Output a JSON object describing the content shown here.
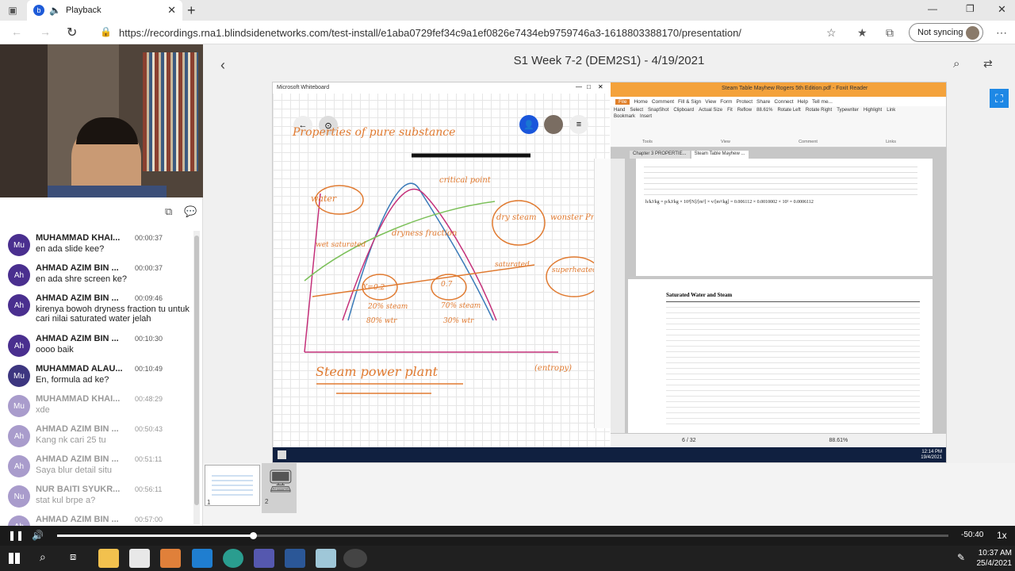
{
  "browser": {
    "tab_title": "Playback",
    "url": "https://recordings.rna1.blindsidenetworks.com/test-install/e1aba0729fef34c9a1ef0826e7434eb9759746a3-1618803388170/presentation/",
    "sync_label": "Not syncing"
  },
  "presentation": {
    "title": "S1 Week 7-2 (DEM2S1) - 4/19/2021",
    "whiteboard_title": "Microsoft Whiteboard",
    "pdf_title": "Steam Table Mayhew Rogers 5th Edition.pdf - Foxit Reader",
    "pdf_tabs": [
      "Chapter 3 PROPERTIE...",
      "Steam Table Mayhew ..."
    ],
    "pdf_menu": [
      "File",
      "Home",
      "Comment",
      "Fill & Sign",
      "View",
      "Form",
      "Protect",
      "Share",
      "Connect",
      "Help",
      "Tell me..."
    ],
    "pdf_tools": [
      "Hand",
      "Select",
      "SnapShot",
      "Clipboard",
      "Actual Size",
      "Fit",
      "Reflow",
      "88.61%",
      "Rotate Left",
      "Rotate Right",
      "Typewriter",
      "Highlight",
      "Link",
      "Bookmark",
      "Insert"
    ],
    "pdf_groups": [
      "Tools",
      "View",
      "Comment",
      "Links"
    ],
    "table_title": "Saturated Water and Steam",
    "page_indicator": "6 / 32",
    "zoom": "88.61%",
    "clock_time": "12:14 PM",
    "clock_date": "19/4/2021",
    "whiteboard_text": [
      "Properties of pure substance",
      "critical point",
      "water",
      "dry steam",
      "dryness fraction",
      "wet saturated",
      "saturated",
      "X=0.2",
      "0.7",
      "20% steam",
      "70% steam",
      "80% wtr",
      "30% wtr",
      "superheated steam",
      "Steam power plant",
      "(entropy)",
      "wonster Press"
    ]
  },
  "chat": {
    "messages": [
      {
        "initials": "Mu",
        "name": "MUHAMMAD KHAI...",
        "time": "00:00:37",
        "text": "en ada slide kee?",
        "color": "#4a2f8f",
        "faded": false
      },
      {
        "initials": "Ah",
        "name": "AHMAD AZIM BIN ...",
        "time": "00:00:37",
        "text": "en ada shre screen ke?",
        "color": "#4a2f8f",
        "faded": false
      },
      {
        "initials": "Ah",
        "name": "AHMAD AZIM BIN ...",
        "time": "00:09:46",
        "text": "kirenya bowoh dryness fraction tu untuk cari nilai saturated water jelah",
        "color": "#4a2f8f",
        "faded": false
      },
      {
        "initials": "Ah",
        "name": "AHMAD AZIM BIN ...",
        "time": "00:10:30",
        "text": "oooo baik",
        "color": "#4a2f8f",
        "faded": false
      },
      {
        "initials": "Mu",
        "name": "MUHAMMAD ALAU...",
        "time": "00:10:49",
        "text": "En, formula ad ke?",
        "color": "#3d3680",
        "faded": false
      },
      {
        "initials": "Mu",
        "name": "MUHAMMAD KHAI...",
        "time": "00:48:29",
        "text": "xde",
        "color": "#a99ccc",
        "faded": true
      },
      {
        "initials": "Ah",
        "name": "AHMAD AZIM BIN ...",
        "time": "00:50:43",
        "text": "Kang nk cari 25 tu",
        "color": "#a99ccc",
        "faded": true
      },
      {
        "initials": "Ah",
        "name": "AHMAD AZIM BIN ...",
        "time": "00:51:11",
        "text": "Saya blur detail situ",
        "color": "#a99ccc",
        "faded": true
      },
      {
        "initials": "Nu",
        "name": "NUR BAITI SYUKR...",
        "time": "00:56:11",
        "text": "stat kul brpe a?",
        "color": "#a99ccc",
        "faded": true
      },
      {
        "initials": "Ah",
        "name": "AHMAD AZIM BIN ...",
        "time": "00:57:00",
        "text": "",
        "color": "#a99ccc",
        "faded": true
      }
    ]
  },
  "thumbnails": [
    "1",
    "2"
  ],
  "player": {
    "time_remaining": "-50:40",
    "speed": "1x",
    "progress": 0.22
  },
  "taskbar": {
    "time": "10:37 AM",
    "date": "25/4/2021"
  }
}
